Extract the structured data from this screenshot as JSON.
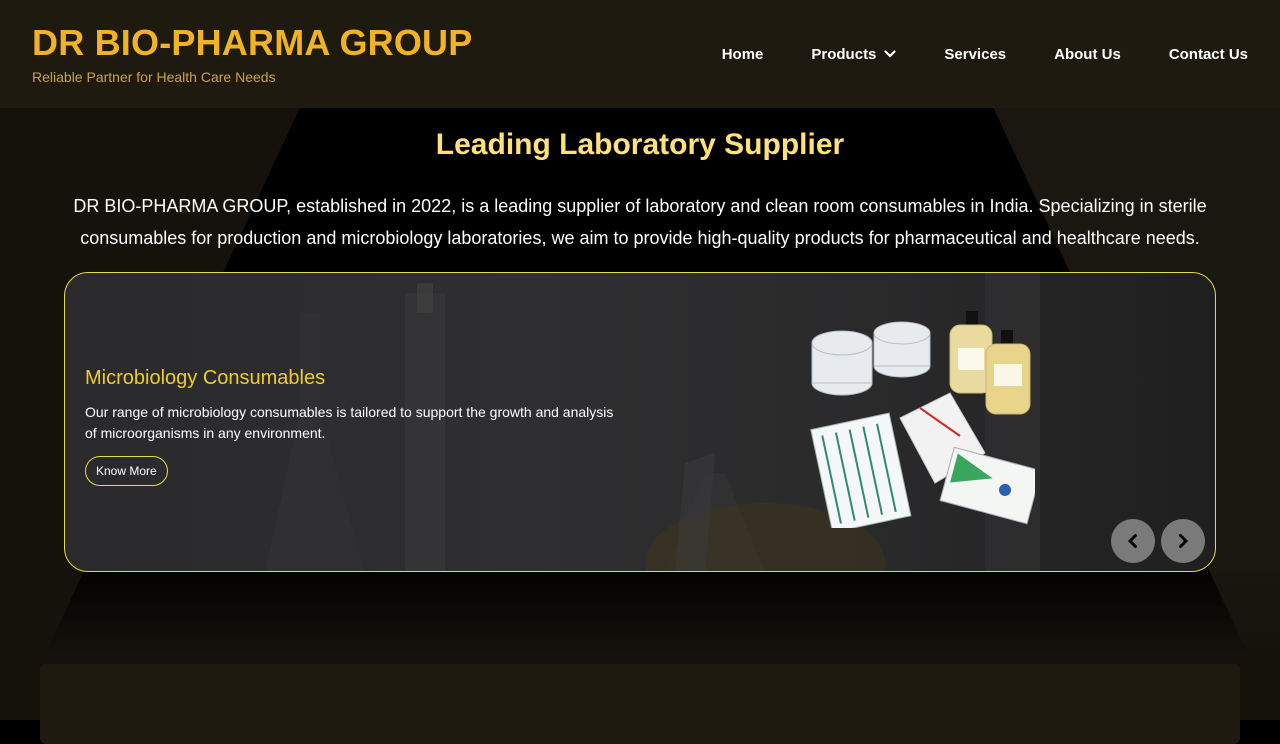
{
  "header": {
    "brand_title": "DR BIO-PHARMA GROUP",
    "tagline": "Reliable Partner for Health Care Needs",
    "nav": [
      {
        "label": "Home"
      },
      {
        "label": "Products",
        "icon": "chevron-down-icon"
      },
      {
        "label": "Services"
      },
      {
        "label": "About Us"
      },
      {
        "label": "Contact Us"
      }
    ]
  },
  "hero": {
    "title": "Leading Laboratory Supplier",
    "description": "DR BIO-PHARMA GROUP, established in 2022, is a leading supplier of laboratory and clean room consumables in India. Specializing in sterile consumables for production and microbiology laboratories, we aim to provide high-quality products for pharmaceutical and healthcare needs."
  },
  "carousel": {
    "slide": {
      "title": "Microbiology Consumables",
      "description": "Our range of microbiology consumables is tailored to support the growth and analysis of microorganisms in any environment.",
      "button": "Know More"
    },
    "prev_icon": "chevron-left-icon",
    "next_icon": "chevron-right-icon"
  },
  "colors": {
    "brand": "#f0b323",
    "heading": "#ffe07a",
    "accent_border": "#e6d94a",
    "header_bg": "#1f1a10"
  }
}
